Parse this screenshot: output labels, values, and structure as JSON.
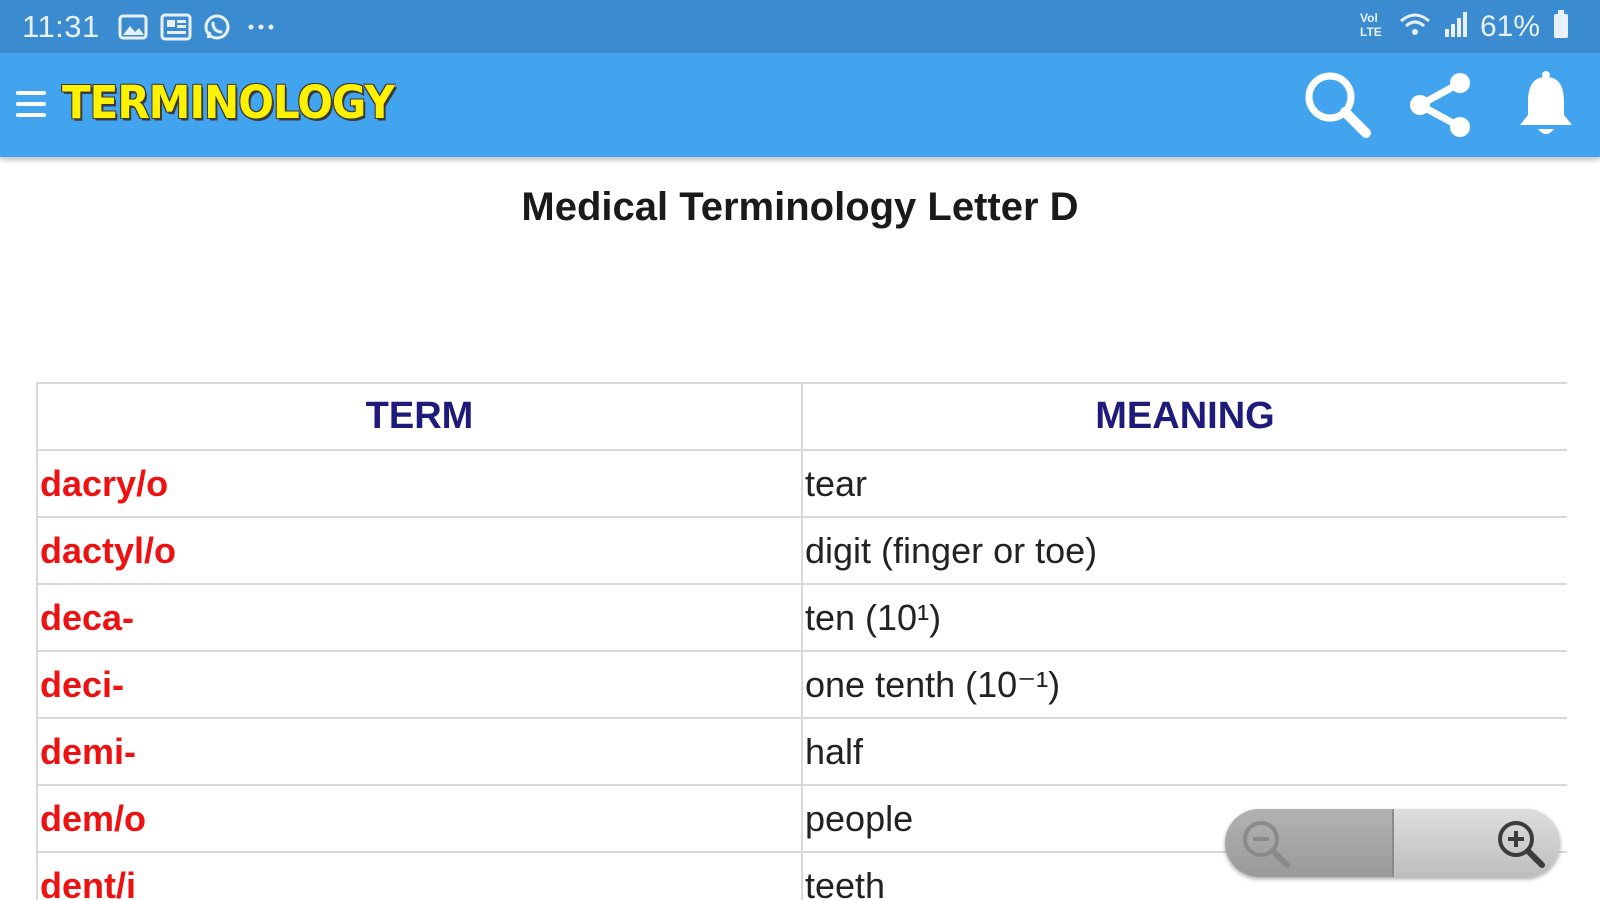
{
  "status_bar": {
    "time": "11:31",
    "battery": "61%",
    "icons": [
      "gallery-icon",
      "news-icon",
      "whatsapp-icon",
      "more-icon",
      "volte-icon",
      "wifi-icon",
      "signal-icon",
      "battery-icon"
    ]
  },
  "app_bar": {
    "title": "TERMINOLOGY",
    "actions": [
      "search-icon",
      "share-icon",
      "bell-icon"
    ],
    "colors": {
      "bar": "#42a4ef",
      "title": "#fff200"
    }
  },
  "page": {
    "title": "Medical Terminology Letter D"
  },
  "table": {
    "headers": {
      "term": "TERM",
      "meaning": "MEANING"
    },
    "rows": [
      {
        "term": "dacry/o",
        "meaning": "tear"
      },
      {
        "term": "dactyl/o",
        "meaning": "digit (finger or toe)"
      },
      {
        "term": "deca-",
        "meaning": "ten (10¹)"
      },
      {
        "term": "deci-",
        "meaning": "one tenth (10⁻¹)"
      },
      {
        "term": "demi-",
        "meaning": "half"
      },
      {
        "term": "dem/o",
        "meaning": "people"
      },
      {
        "term": "dent/i",
        "meaning": "teeth"
      }
    ],
    "colors": {
      "term": "#ee1111",
      "header": "#1f1b7a"
    }
  },
  "zoom": {
    "controls": [
      "zoom-out-icon",
      "zoom-in-icon"
    ]
  }
}
